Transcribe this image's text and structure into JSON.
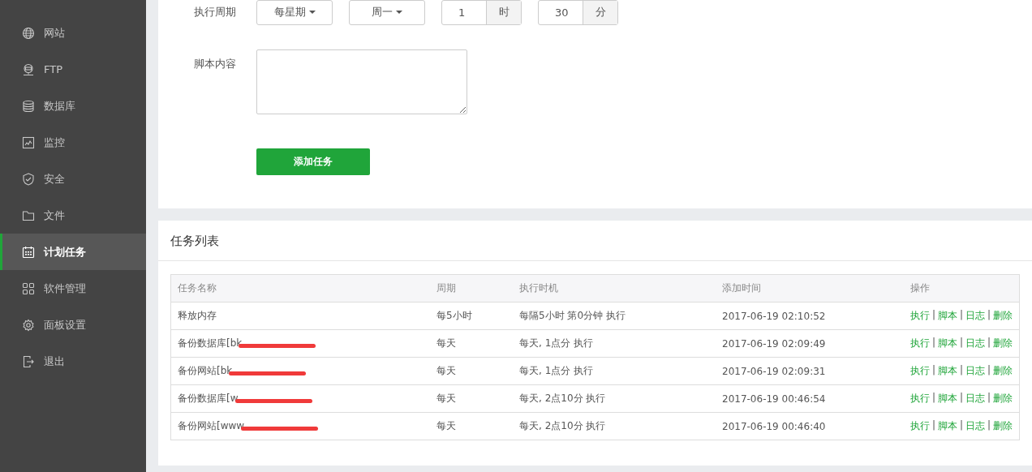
{
  "sidebar": {
    "items": [
      {
        "label": "网站",
        "selected": false
      },
      {
        "label": "FTP",
        "selected": false
      },
      {
        "label": "数据库",
        "selected": false
      },
      {
        "label": "监控",
        "selected": false
      },
      {
        "label": "安全",
        "selected": false
      },
      {
        "label": "文件",
        "selected": false
      },
      {
        "label": "计划任务",
        "selected": true
      },
      {
        "label": "软件管理",
        "selected": false
      },
      {
        "label": "面板设置",
        "selected": false
      },
      {
        "label": "退出",
        "selected": false
      }
    ]
  },
  "form": {
    "period_label": "执行周期",
    "period_type": "每星期",
    "weekday": "周一",
    "hour": "1",
    "hour_unit": "时",
    "minute": "30",
    "minute_unit": "分",
    "script_label": "脚本内容",
    "submit": "添加任务"
  },
  "task_list": {
    "title": "任务列表",
    "action_separator": "|",
    "columns": [
      "任务名称",
      "周期",
      "执行时机",
      "添加时间",
      "操作"
    ],
    "rows": [
      {
        "name": "释放内存",
        "redacted": false,
        "period": "每5小时",
        "timing": "每隔5小时 第0分钟 执行",
        "added": "2017-06-19 02:10:52",
        "actions": [
          "执行",
          "脚本",
          "日志",
          "删除"
        ]
      },
      {
        "name": "备份数据库[bk",
        "redacted": true,
        "period": "每天",
        "timing": "每天, 1点分 执行",
        "added": "2017-06-19 02:09:49",
        "actions": [
          "执行",
          "脚本",
          "日志",
          "删除"
        ]
      },
      {
        "name": "备份网站[bk",
        "redacted": true,
        "period": "每天",
        "timing": "每天, 1点分 执行",
        "added": "2017-06-19 02:09:31",
        "actions": [
          "执行",
          "脚本",
          "日志",
          "删除"
        ]
      },
      {
        "name": "备份数据库[w",
        "redacted": true,
        "period": "每天",
        "timing": "每天, 2点10分 执行",
        "added": "2017-06-19 00:46:54",
        "actions": [
          "执行",
          "脚本",
          "日志",
          "删除"
        ]
      },
      {
        "name": "备份网站[www",
        "redacted": true,
        "period": "每天",
        "timing": "每天, 2点10分 执行",
        "added": "2017-06-19 00:46:40",
        "actions": [
          "执行",
          "脚本",
          "日志",
          "删除"
        ]
      }
    ]
  }
}
